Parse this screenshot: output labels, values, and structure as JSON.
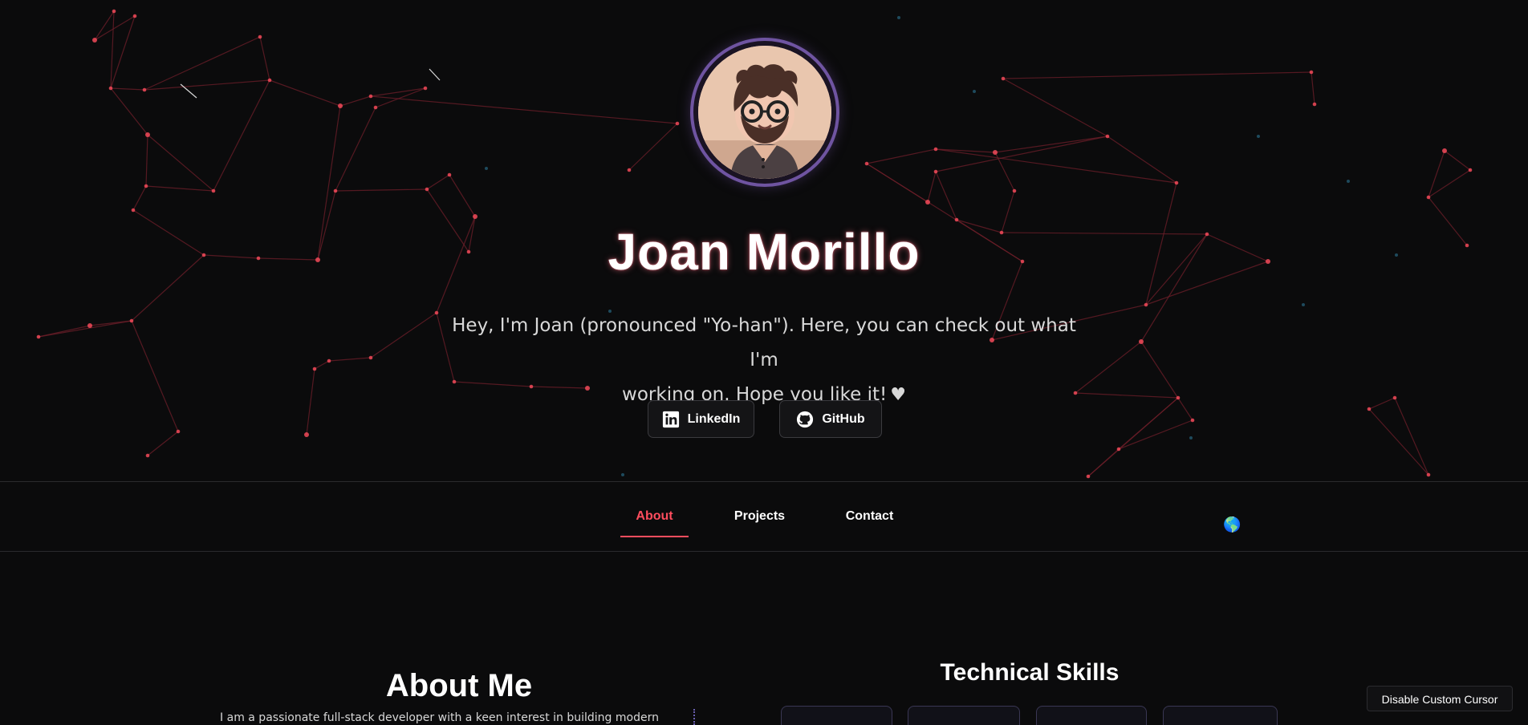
{
  "hero": {
    "name": "Joan Morillo",
    "subtitle_line1": "Hey, I'm Joan (pronounced \"Yo-han\"). Here, you can check out what I'm",
    "subtitle_line2": "working on. Hope you like it!",
    "heart_icon": "♥",
    "avatar": "avatar-illustration"
  },
  "social": {
    "linkedin_label": "LinkedIn",
    "github_label": "GitHub",
    "linkedin_icon": "linkedin-icon",
    "github_icon": "github-icon"
  },
  "nav": {
    "items": [
      {
        "label": "About",
        "active": true
      },
      {
        "label": "Projects",
        "active": false
      },
      {
        "label": "Contact",
        "active": false
      }
    ],
    "globe_icon": "🌎"
  },
  "about": {
    "title": "About Me",
    "text_preview": "I am a passionate full-stack developer with a keen interest in building modern"
  },
  "skills": {
    "title": "Technical Skills",
    "cards": [
      "",
      "",
      "",
      ""
    ]
  },
  "footer": {
    "cursor_toggle_label": "Disable Custom Cursor"
  },
  "theme": {
    "accent": "#ff4d5e",
    "background": "#0b0b0c",
    "node_color": "#ff4d5e",
    "edge_color": "#6f1f2a",
    "avatar_border": "#6f54a1"
  }
}
